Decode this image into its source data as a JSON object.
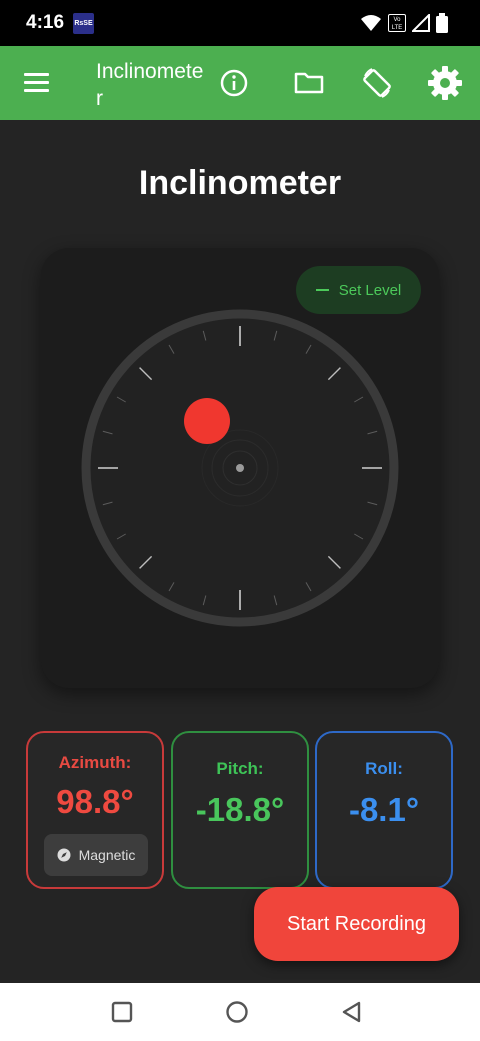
{
  "status_bar": {
    "time": "4:16",
    "app_logo_text": "RsSE",
    "volte_line1": "Vo",
    "volte_line2": "LTE"
  },
  "app_bar": {
    "title": "Inclinometer",
    "color": "#4caf50",
    "icons": [
      "menu-icon",
      "info-icon",
      "folder-icon",
      "screen-rotation-icon",
      "settings-icon"
    ]
  },
  "page": {
    "title": "Inclinometer"
  },
  "level": {
    "set_level_label": "Set Level"
  },
  "readings": {
    "azimuth": {
      "label": "Azimuth:",
      "value": "98.8°",
      "mode_label": "Magnetic",
      "color": "#ef4a40"
    },
    "pitch": {
      "label": "Pitch:",
      "value": "-18.8°",
      "color": "#49c65c"
    },
    "roll": {
      "label": "Roll:",
      "value": "-8.1°",
      "color": "#3b8fef"
    }
  },
  "actions": {
    "start_recording_label": "Start Recording"
  },
  "nav_bar": {
    "icons": [
      "recents-square-icon",
      "home-circle-icon",
      "back-triangle-icon"
    ]
  }
}
